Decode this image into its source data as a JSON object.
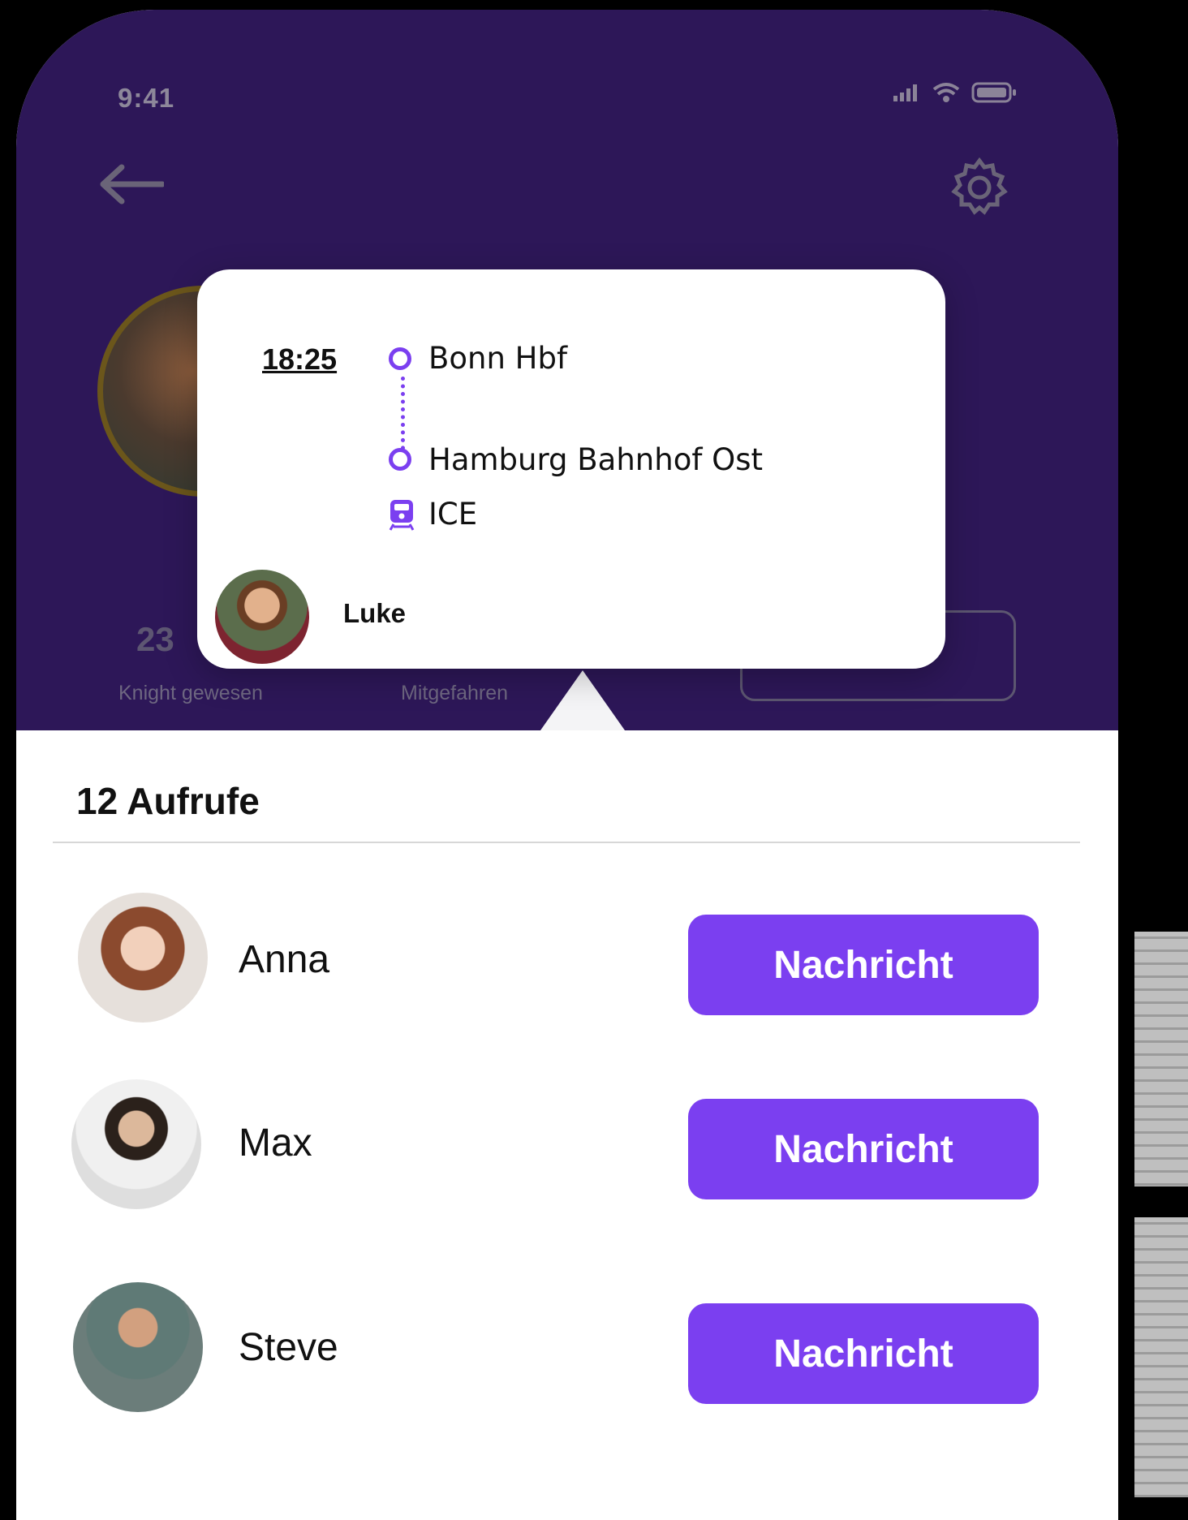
{
  "status_bar": {
    "time": "9:41"
  },
  "header": {
    "stats": [
      {
        "value": "23",
        "label": "Knight gewesen"
      },
      {
        "value": "",
        "label": "Mitgefahren"
      }
    ],
    "button_label": ""
  },
  "popup": {
    "time": "18:25",
    "stops": [
      {
        "name": "Bonn Hbf"
      },
      {
        "name": "Hamburg Bahnhof Ost"
      }
    ],
    "train": "ICE",
    "user": "Luke"
  },
  "section": {
    "title": "12 Aufrufe"
  },
  "people": [
    {
      "name": "Anna",
      "action": "Nachricht"
    },
    {
      "name": "Max",
      "action": "Nachricht"
    },
    {
      "name": "Steve",
      "action": "Nachricht"
    }
  ],
  "colors": {
    "header_bg": "#2d1758",
    "accent": "#7b3ff0"
  },
  "icons": [
    "back-arrow-icon",
    "gear-icon",
    "signal-icon",
    "wifi-icon",
    "battery-icon",
    "train-icon"
  ]
}
